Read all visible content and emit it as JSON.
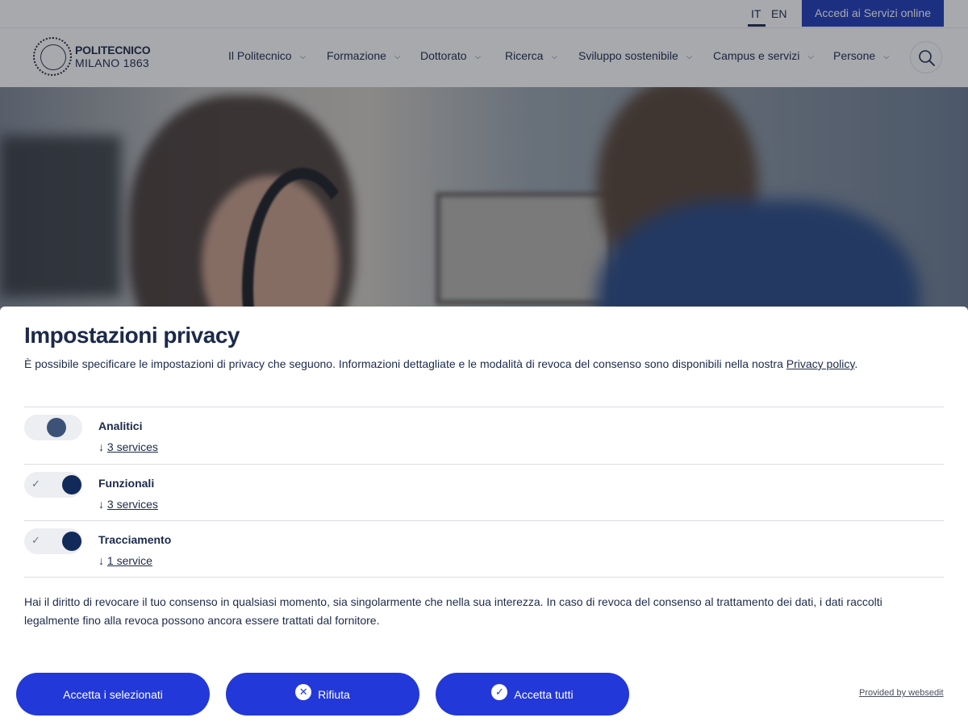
{
  "topbar": {
    "lang_it": "IT",
    "lang_en": "EN",
    "services_button": "Accedi ai Servizi online"
  },
  "logo": {
    "line1": "POLITECNICO",
    "line2": "MILANO 1863"
  },
  "nav": {
    "items": [
      {
        "label": "Il Politecnico"
      },
      {
        "label": "Formazione"
      },
      {
        "label": "Dottorato"
      },
      {
        "label": "Ricerca"
      },
      {
        "label": "Sviluppo sostenibile"
      },
      {
        "label": "Campus e servizi"
      },
      {
        "label": "Persone"
      }
    ],
    "search_icon": "search-icon"
  },
  "privacy": {
    "title": "Impostazioni privacy",
    "description": "È possibile specificare le impostazioni di privacy che seguono. Informazioni dettagliate e le modalità di revoca del consenso sono disponibili nella nostra ",
    "policy_link": "Privacy policy",
    "description_end": ".",
    "categories": [
      {
        "label": "Analitici",
        "services": "3 services",
        "enabled": false
      },
      {
        "label": "Funzionali",
        "services": "3 services",
        "enabled": true
      },
      {
        "label": "Tracciamento",
        "services": "1 service",
        "enabled": true
      }
    ],
    "arrow": "↓",
    "check_glyph": "✓",
    "note": "Hai il diritto di revocare il tuo consenso in qualsiasi momento, sia singolarmente che nella sua interezza. In caso di revoca del consenso al trattamento dei dati, i dati raccolti legalmente fino alla revoca possono ancora essere trattati dal fornitore."
  },
  "buttons": {
    "accept_selected": "Accetta i selezionati",
    "reject": "Rifiuta",
    "reject_icon": "close-circle-icon",
    "accept_all": "Accetta tutti",
    "accept_all_icon": "check-circle-icon",
    "provided_by": "Provided by websedit"
  },
  "colors": {
    "primary_button": "#2338d8",
    "navy_text": "#1c2a4a",
    "services_button": "#1f3ab8"
  }
}
